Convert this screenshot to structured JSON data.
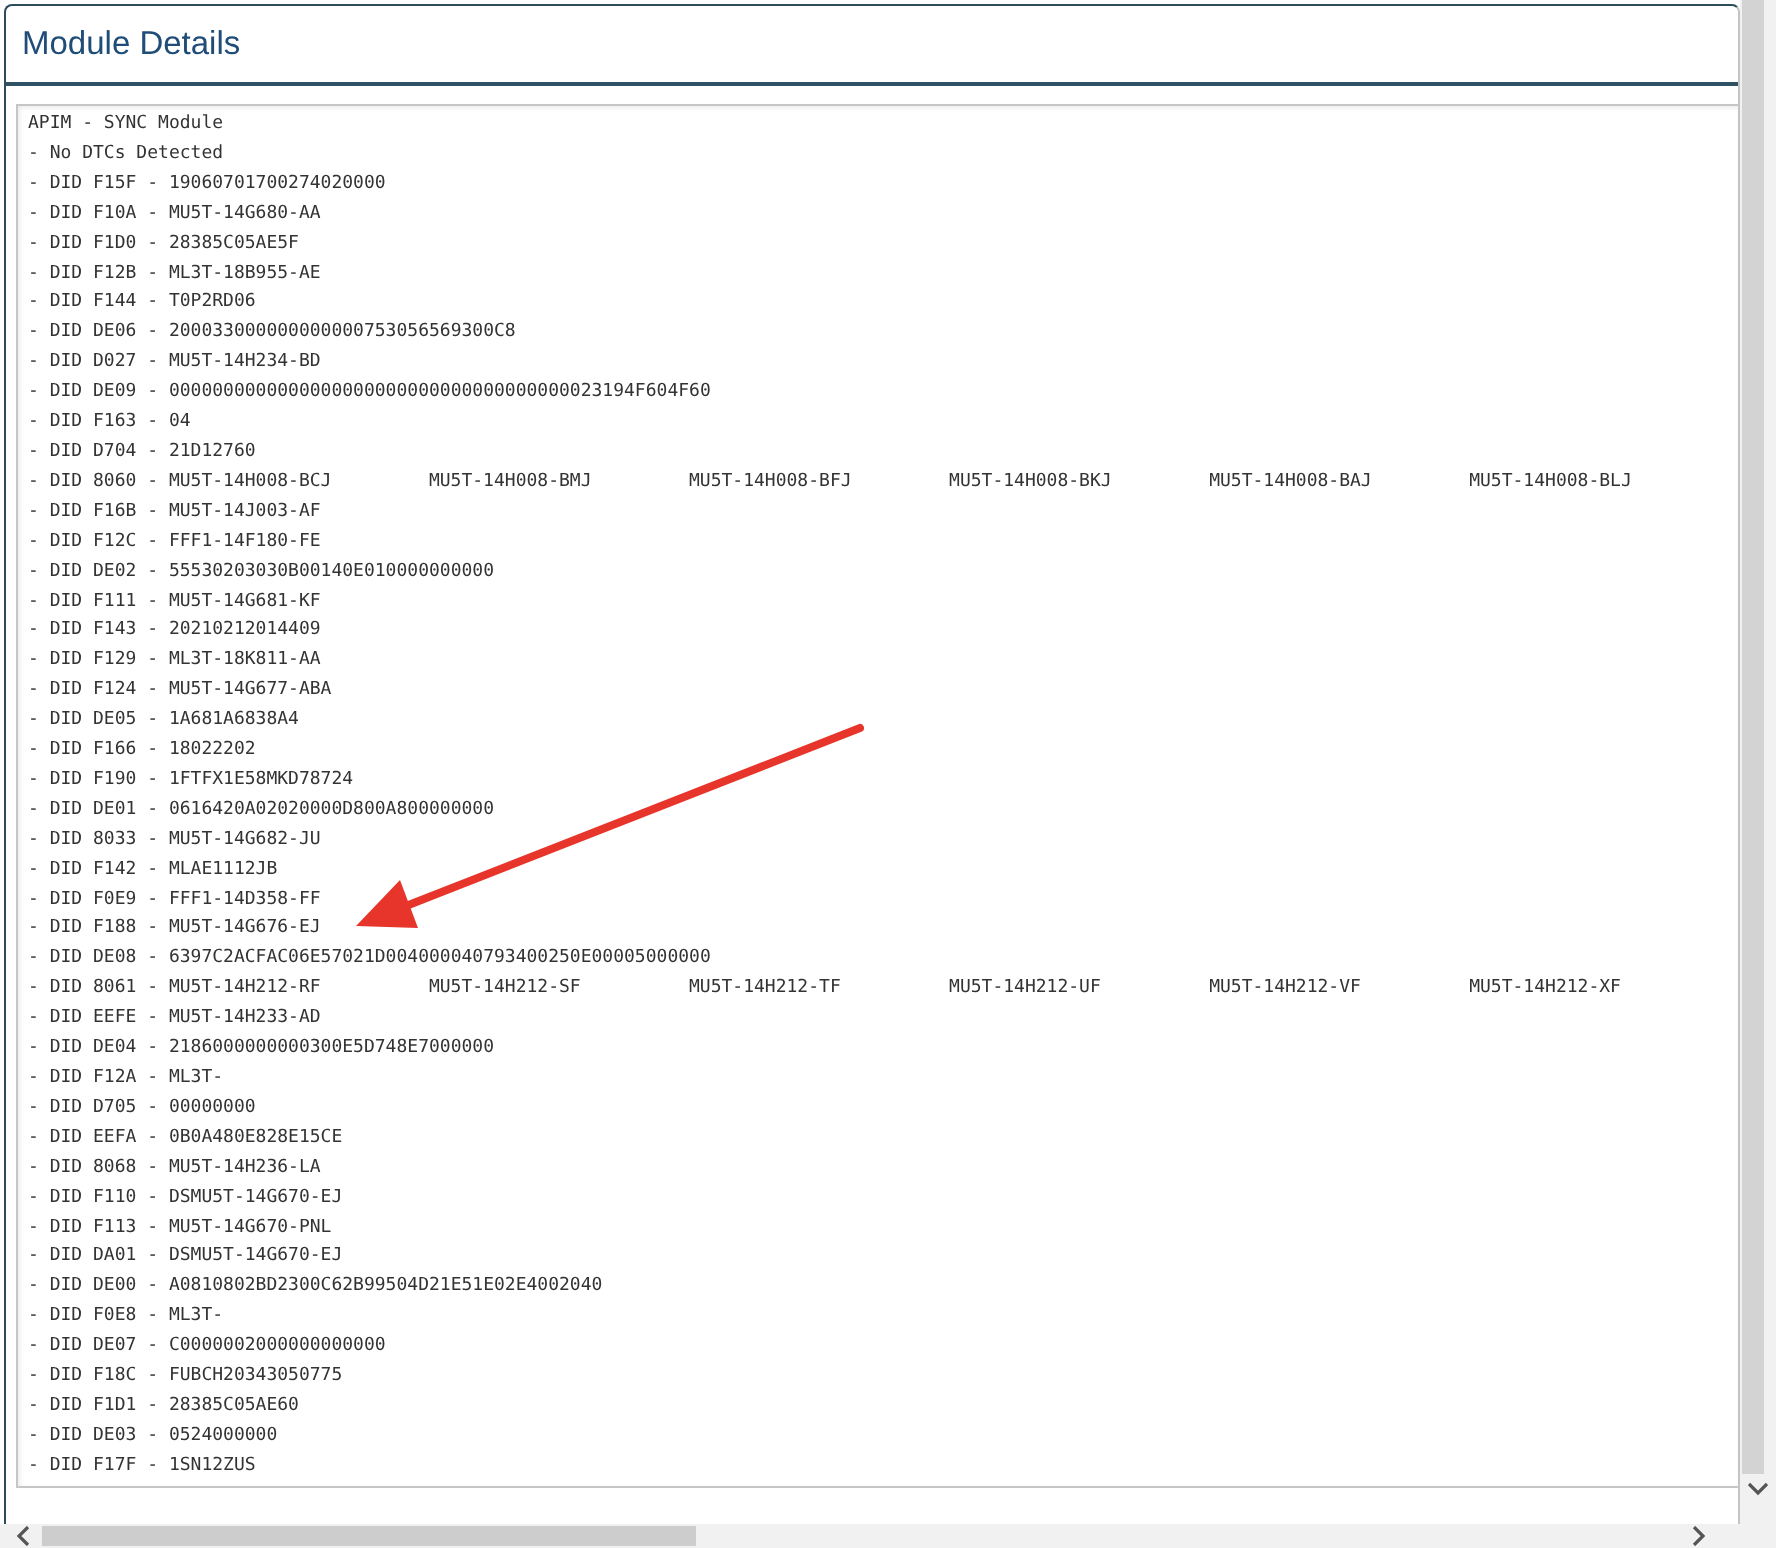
{
  "panel": {
    "title": "Module Details"
  },
  "listing": {
    "lines": [
      {
        "cells": [
          "APIM - SYNC Module"
        ]
      },
      {
        "cells": [
          "- No DTCs Detected"
        ]
      },
      {
        "cells": [
          "- DID F15F - 19060701700274020000"
        ]
      },
      {
        "cells": [
          "- DID F10A - MU5T-14G680-AA"
        ]
      },
      {
        "cells": [
          "- DID F1D0 - 28385C05AE5F"
        ]
      },
      {
        "cells": [
          "- DID F12B - ML3T-18B955-AE"
        ]
      },
      {
        "cells": [
          "- DID F144 - T0P2RD06"
        ]
      },
      {
        "cells": [
          "- DID DE06 - 200033000000000000753056569300C8"
        ]
      },
      {
        "cells": [
          "- DID D027 - MU5T-14H234-BD"
        ]
      },
      {
        "cells": [
          "- DID DE09 - 0000000000000000000000000000000000000023194F604F60"
        ]
      },
      {
        "cells": [
          "- DID F163 - 04"
        ]
      },
      {
        "cells": [
          "- DID D704 - 21D12760"
        ]
      },
      {
        "cells": [
          "- DID 8060 - MU5T-14H008-BCJ",
          "MU5T-14H008-BMJ",
          "MU5T-14H008-BFJ",
          "MU5T-14H008-BKJ",
          "MU5T-14H008-BAJ",
          "MU5T-14H008-BLJ"
        ]
      },
      {
        "cells": [
          "- DID F16B - MU5T-14J003-AF"
        ]
      },
      {
        "cells": [
          "- DID F12C - FFF1-14F180-FE"
        ]
      },
      {
        "cells": [
          "- DID DE02 - 55530203030B00140E010000000000"
        ]
      },
      {
        "cells": [
          "- DID F111 - MU5T-14G681-KF"
        ]
      },
      {
        "cells": [
          "- DID F143 - 20210212014409"
        ]
      },
      {
        "cells": [
          "- DID F129 - ML3T-18K811-AA"
        ]
      },
      {
        "cells": [
          "- DID F124 - MU5T-14G677-ABA"
        ]
      },
      {
        "cells": [
          "- DID DE05 - 1A681A6838A4"
        ]
      },
      {
        "cells": [
          "- DID F166 - 18022202"
        ]
      },
      {
        "cells": [
          "- DID F190 - 1FTFX1E58MKD78724"
        ]
      },
      {
        "cells": [
          "- DID DE01 - 0616420A02020000D800A800000000"
        ]
      },
      {
        "cells": [
          "- DID 8033 - MU5T-14G682-JU"
        ]
      },
      {
        "cells": [
          "- DID F142 - MLAE1112JB"
        ]
      },
      {
        "cells": [
          "- DID F0E9 - FFF1-14D358-FF"
        ]
      },
      {
        "cells": [
          "- DID F188 - MU5T-14G676-EJ"
        ]
      },
      {
        "cells": [
          "- DID DE08 - 6397C2ACFAC06E57021D004000040793400250E00005000000"
        ]
      },
      {
        "cells": [
          "- DID 8061 - MU5T-14H212-RF",
          "MU5T-14H212-SF",
          "MU5T-14H212-TF",
          "MU5T-14H212-UF",
          "MU5T-14H212-VF",
          "MU5T-14H212-XF"
        ]
      },
      {
        "cells": [
          "- DID EEFE - MU5T-14H233-AD"
        ]
      },
      {
        "cells": [
          "- DID DE04 - 2186000000000300E5D748E7000000"
        ]
      },
      {
        "cells": [
          "- DID F12A - ML3T-"
        ]
      },
      {
        "cells": [
          "- DID D705 - 00000000"
        ]
      },
      {
        "cells": [
          "- DID EEFA - 0B0A480E828E15CE"
        ]
      },
      {
        "cells": [
          "- DID 8068 - MU5T-14H236-LA"
        ]
      },
      {
        "cells": [
          "- DID F110 - DSMU5T-14G670-EJ"
        ]
      },
      {
        "cells": [
          "- DID F113 - MU5T-14G670-PNL"
        ]
      },
      {
        "cells": [
          "- DID DA01 - DSMU5T-14G670-EJ"
        ]
      },
      {
        "cells": [
          "- DID DE00 - A0810802BD2300C62B99504D21E51E02E4002040"
        ]
      },
      {
        "cells": [
          "- DID F0E8 - ML3T-"
        ]
      },
      {
        "cells": [
          "- DID DE07 - C0000002000000000000"
        ]
      },
      {
        "cells": [
          "- DID F18C - FUBCH20343050775"
        ]
      },
      {
        "cells": [
          "- DID F1D1 - 28385C05AE60"
        ]
      },
      {
        "cells": [
          "- DID DE03 - 0524000000"
        ]
      },
      {
        "cells": [
          "- DID F17F - 1SN12ZUS"
        ]
      }
    ]
  }
}
